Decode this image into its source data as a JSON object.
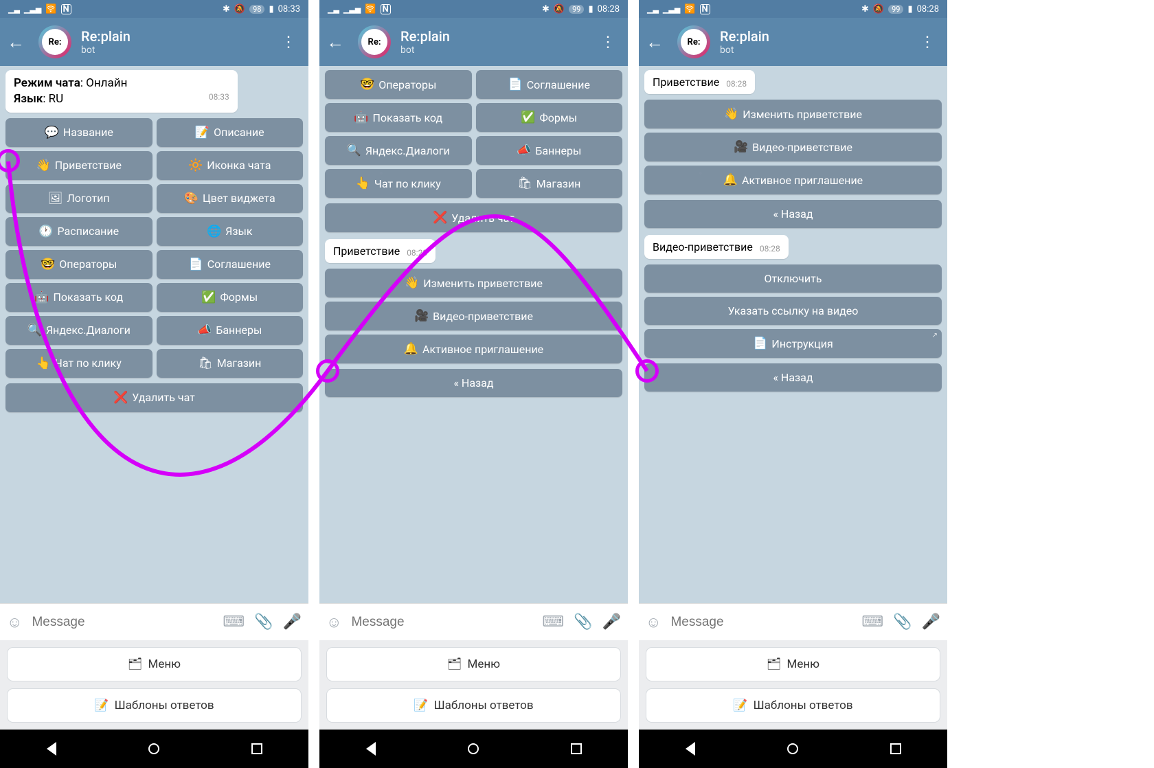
{
  "status": {
    "battery1": "98",
    "time1": "08:33",
    "battery2": "99",
    "time2": "08:28",
    "battery3": "99",
    "time3": "08:28"
  },
  "header": {
    "title": "Re:plain",
    "subtitle": "bot",
    "avatar": "Re:"
  },
  "input": {
    "placeholder": "Message"
  },
  "reply_kb": {
    "menu": "Меню",
    "templates": "Шаблоны ответов",
    "menu_emoji": "🗂",
    "templates_emoji": "📝"
  },
  "screen1": {
    "msg": {
      "mode_label": "Режим чата",
      "mode_value": ": Онлайн",
      "lang_label": "Язык",
      "lang_value": ": RU",
      "time": "08:33"
    },
    "buttons": [
      {
        "e": "💬",
        "t": "Название"
      },
      {
        "e": "📝",
        "t": "Описание"
      },
      {
        "e": "👋",
        "t": "Приветствие"
      },
      {
        "e": "🔆",
        "t": "Иконка чата"
      },
      {
        "e": "🖼",
        "t": "Логотип"
      },
      {
        "e": "🎨",
        "t": "Цвет виджета"
      },
      {
        "e": "🕐",
        "t": "Расписание"
      },
      {
        "e": "🌐",
        "t": "Язык"
      },
      {
        "e": "🤓",
        "t": "Операторы"
      },
      {
        "e": "📄",
        "t": "Соглашение"
      },
      {
        "e": "🤖",
        "t": "Показать код"
      },
      {
        "e": "✅",
        "t": "Формы"
      },
      {
        "e": "🔍",
        "t": "Яндекс.Диалоги"
      },
      {
        "e": "📣",
        "t": "Баннеры"
      },
      {
        "e": "👆",
        "t": "Чат по клику"
      },
      {
        "e": "🛍",
        "t": "Магазин"
      }
    ],
    "delete": {
      "e": "❌",
      "t": "Удалить чат"
    }
  },
  "screen2": {
    "buttons_top": [
      {
        "e": "🤓",
        "t": "Операторы"
      },
      {
        "e": "📄",
        "t": "Соглашение"
      },
      {
        "e": "🤖",
        "t": "Показать код"
      },
      {
        "e": "✅",
        "t": "Формы"
      },
      {
        "e": "🔍",
        "t": "Яндекс.Диалоги"
      },
      {
        "e": "📣",
        "t": "Баннеры"
      },
      {
        "e": "👆",
        "t": "Чат по клику"
      },
      {
        "e": "🛍",
        "t": "Магазин"
      }
    ],
    "delete": {
      "e": "❌",
      "t": "Удалить чат"
    },
    "msg": {
      "text": "Приветствие",
      "time": "08:28"
    },
    "buttons_bottom": [
      {
        "e": "👋",
        "t": "Изменить приветствие"
      },
      {
        "e": "🎥",
        "t": "Видео-приветствие"
      },
      {
        "e": "🔔",
        "t": "Активное приглашение"
      }
    ],
    "back": "« Назад"
  },
  "screen3": {
    "msg1": {
      "text": "Приветствие",
      "time": "08:28"
    },
    "buttons1": [
      {
        "e": "👋",
        "t": "Изменить приветствие"
      },
      {
        "e": "🎥",
        "t": "Видео-приветствие"
      },
      {
        "e": "🔔",
        "t": "Активное приглашение"
      }
    ],
    "back": "« Назад",
    "msg2": {
      "text": "Видео-приветствие",
      "time": "08:28"
    },
    "buttons2": [
      {
        "e": "",
        "t": "Отключить"
      },
      {
        "e": "",
        "t": "Указать ссылку на видео"
      },
      {
        "e": "📄",
        "t": "Инструкция",
        "link": true
      }
    ]
  }
}
